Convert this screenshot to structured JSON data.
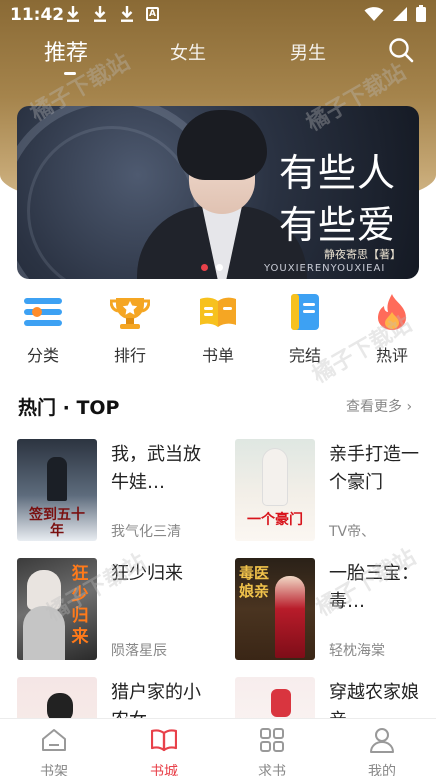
{
  "status_bar": {
    "time": "11:42",
    "badge": "A"
  },
  "top_tabs": {
    "recommend": "推荐",
    "female": "女生",
    "male": "男生"
  },
  "banner": {
    "line1": "有些人",
    "line2": "有些爱",
    "author": "静夜寄思【著】",
    "pinyin": "YOUXIERENYOUXIEAI",
    "slide_count": 2,
    "active_slide": 1
  },
  "categories": [
    {
      "label": "分类",
      "icon": "category-icon"
    },
    {
      "label": "排行",
      "icon": "trophy-icon"
    },
    {
      "label": "书单",
      "icon": "book-list-icon"
    },
    {
      "label": "完结",
      "icon": "finished-icon"
    },
    {
      "label": "热评",
      "icon": "fire-icon"
    }
  ],
  "hot_section": {
    "title": "热门 · TOP",
    "more": "查看更多 ›"
  },
  "books": [
    {
      "title": "我，武当放牛娃…",
      "author": "我气化三清",
      "cover_text": "签到五十年"
    },
    {
      "title": "亲手打造一个豪门",
      "author": "TV帝、",
      "cover_text": "一个豪门"
    },
    {
      "title": "狂少归来",
      "author": "陨落星辰",
      "cover_text": "狂少归来"
    },
    {
      "title": "一胎三宝：毒…",
      "author": "轻枕海棠",
      "cover_text": "毒医娘亲"
    },
    {
      "title": "猎户家的小农女…",
      "author": "",
      "cover_text": ""
    },
    {
      "title": "穿越农家娘亲…",
      "author": "",
      "cover_text": ""
    }
  ],
  "bottom_nav": [
    {
      "label": "书架",
      "icon": "bookshelf-icon",
      "active": false
    },
    {
      "label": "书城",
      "icon": "bookstore-icon",
      "active": true
    },
    {
      "label": "求书",
      "icon": "grid-icon",
      "active": false
    },
    {
      "label": "我的",
      "icon": "profile-icon",
      "active": false
    }
  ],
  "watermark": "橘子下载站",
  "colors": {
    "accent": "#e8414a",
    "header": "#a5844c"
  }
}
